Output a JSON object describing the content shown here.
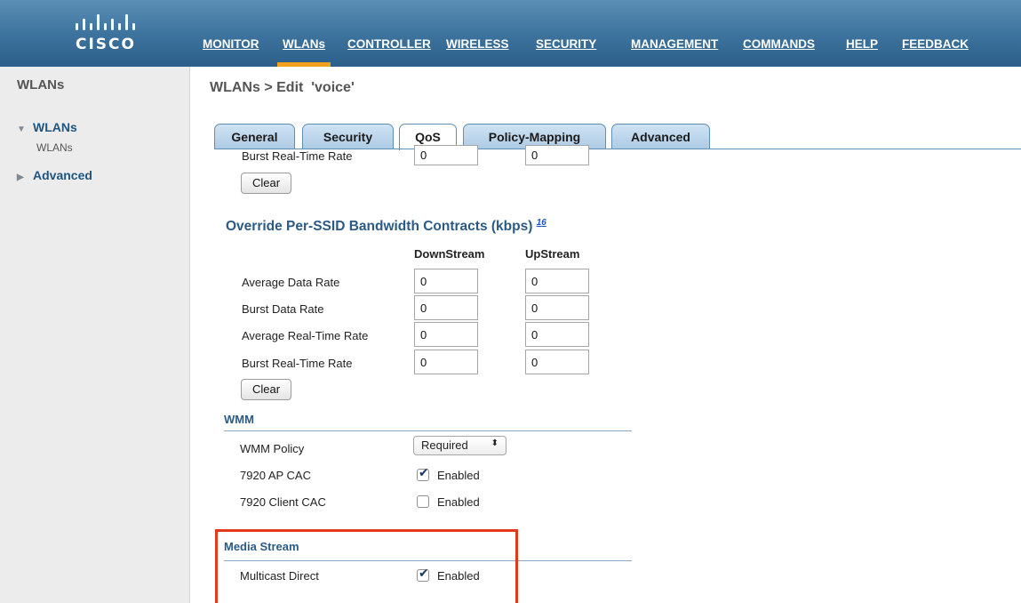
{
  "brand": {
    "name": "CISCO"
  },
  "topnav": [
    {
      "label": "MONITOR"
    },
    {
      "label": "WLANs"
    },
    {
      "label": "CONTROLLER"
    },
    {
      "label": "WIRELESS"
    },
    {
      "label": "SECURITY"
    },
    {
      "label": "MANAGEMENT"
    },
    {
      "label": "COMMANDS"
    },
    {
      "label": "HELP"
    },
    {
      "label": "FEEDBACK"
    }
  ],
  "sidebar": {
    "title": "WLANs",
    "items": [
      {
        "label": "WLANs",
        "sub": "WLANs"
      },
      {
        "label": "Advanced"
      }
    ]
  },
  "page": {
    "title": "WLANs > Edit  'voice'"
  },
  "tabs": [
    {
      "label": "General"
    },
    {
      "label": "Security"
    },
    {
      "label": "QoS"
    },
    {
      "label": "Policy-Mapping"
    },
    {
      "label": "Advanced"
    }
  ],
  "per_user_tail": {
    "burst_rt_label": "Burst Real-Time Rate",
    "burst_rt_down": "0",
    "burst_rt_up": "0",
    "clear_label": "Clear"
  },
  "per_ssid": {
    "title": "Override Per-SSID Bandwidth Contracts (kbps)",
    "footnote": "16",
    "col_down": "DownStream",
    "col_up": "UpStream",
    "rows": [
      {
        "label": "Average Data Rate",
        "down": "0",
        "up": "0"
      },
      {
        "label": "Burst Data Rate",
        "down": "0",
        "up": "0"
      },
      {
        "label": "Average Real-Time Rate",
        "down": "0",
        "up": "0"
      },
      {
        "label": "Burst Real-Time Rate",
        "down": "0",
        "up": "0"
      }
    ],
    "clear_label": "Clear"
  },
  "wmm": {
    "title": "WMM",
    "policy_label": "WMM Policy",
    "policy_value": "Required",
    "ap_cac_label": "7920 AP CAC",
    "ap_cac_text": "Enabled",
    "ap_cac_checked": true,
    "client_cac_label": "7920 Client CAC",
    "client_cac_text": "Enabled",
    "client_cac_checked": false
  },
  "media_stream": {
    "title": "Media Stream",
    "multicast_label": "Multicast Direct",
    "multicast_text": "Enabled",
    "multicast_checked": true
  },
  "colors": {
    "nav_active": "#f0a21c",
    "section_title": "#2b5b85",
    "highlight": "#e0391d"
  }
}
